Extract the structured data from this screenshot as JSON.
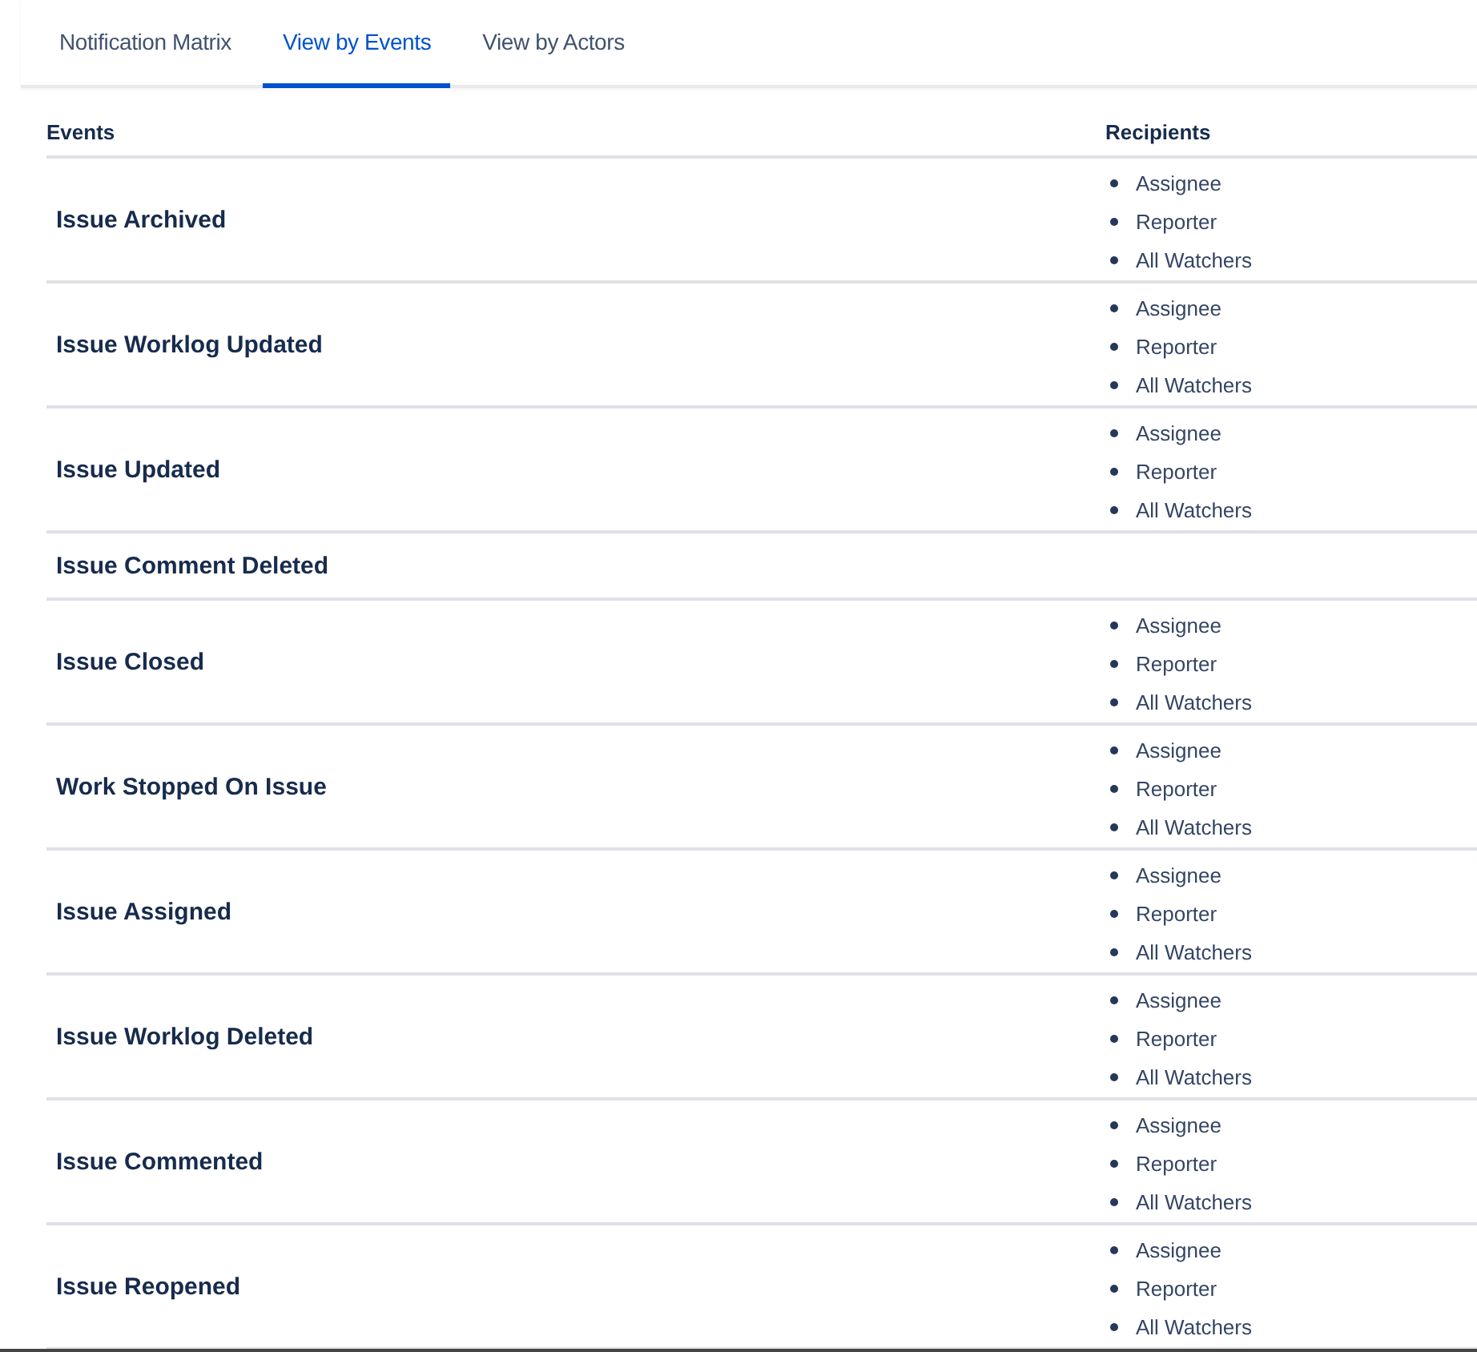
{
  "tabs": [
    {
      "label": "Notification Matrix",
      "selected": false
    },
    {
      "label": "View by Events",
      "selected": true
    },
    {
      "label": "View by Actors",
      "selected": false
    }
  ],
  "table": {
    "columns": [
      "Events",
      "Recipients"
    ],
    "rows": [
      {
        "event": "Issue Archived",
        "recipients": [
          "Assignee",
          "Reporter",
          "All Watchers"
        ]
      },
      {
        "event": "Issue Worklog Updated",
        "recipients": [
          "Assignee",
          "Reporter",
          "All Watchers"
        ]
      },
      {
        "event": "Issue Updated",
        "recipients": [
          "Assignee",
          "Reporter",
          "All Watchers"
        ]
      },
      {
        "event": "Issue Comment Deleted",
        "recipients": []
      },
      {
        "event": "Issue Closed",
        "recipients": [
          "Assignee",
          "Reporter",
          "All Watchers"
        ]
      },
      {
        "event": "Work Stopped On Issue",
        "recipients": [
          "Assignee",
          "Reporter",
          "All Watchers"
        ]
      },
      {
        "event": "Issue Assigned",
        "recipients": [
          "Assignee",
          "Reporter",
          "All Watchers"
        ]
      },
      {
        "event": "Issue Worklog Deleted",
        "recipients": [
          "Assignee",
          "Reporter",
          "All Watchers"
        ]
      },
      {
        "event": "Issue Commented",
        "recipients": [
          "Assignee",
          "Reporter",
          "All Watchers"
        ]
      },
      {
        "event": "Issue Reopened",
        "recipients": [
          "Assignee",
          "Reporter",
          "All Watchers"
        ]
      }
    ]
  }
}
